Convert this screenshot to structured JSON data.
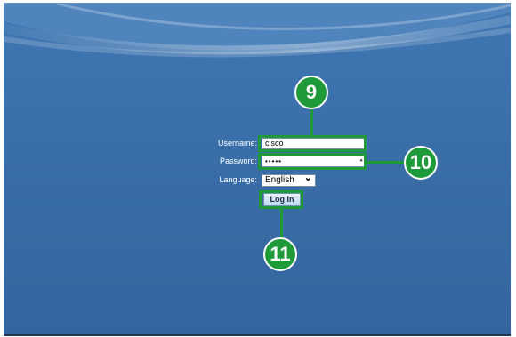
{
  "login_form": {
    "username_label": "Username:",
    "username_value": "cisco",
    "password_label": "Password:",
    "password_value": "•••••",
    "password_reveal_glyph": "●",
    "language_label": "Language:",
    "language_value": "English",
    "language_chevron": "⌄",
    "login_button_label": "Log In"
  },
  "callouts": {
    "username_step": "9",
    "password_step": "10",
    "login_step": "11"
  },
  "colors": {
    "callout_green": "#1f9a3a",
    "background_blue": "#3a6ea8"
  }
}
